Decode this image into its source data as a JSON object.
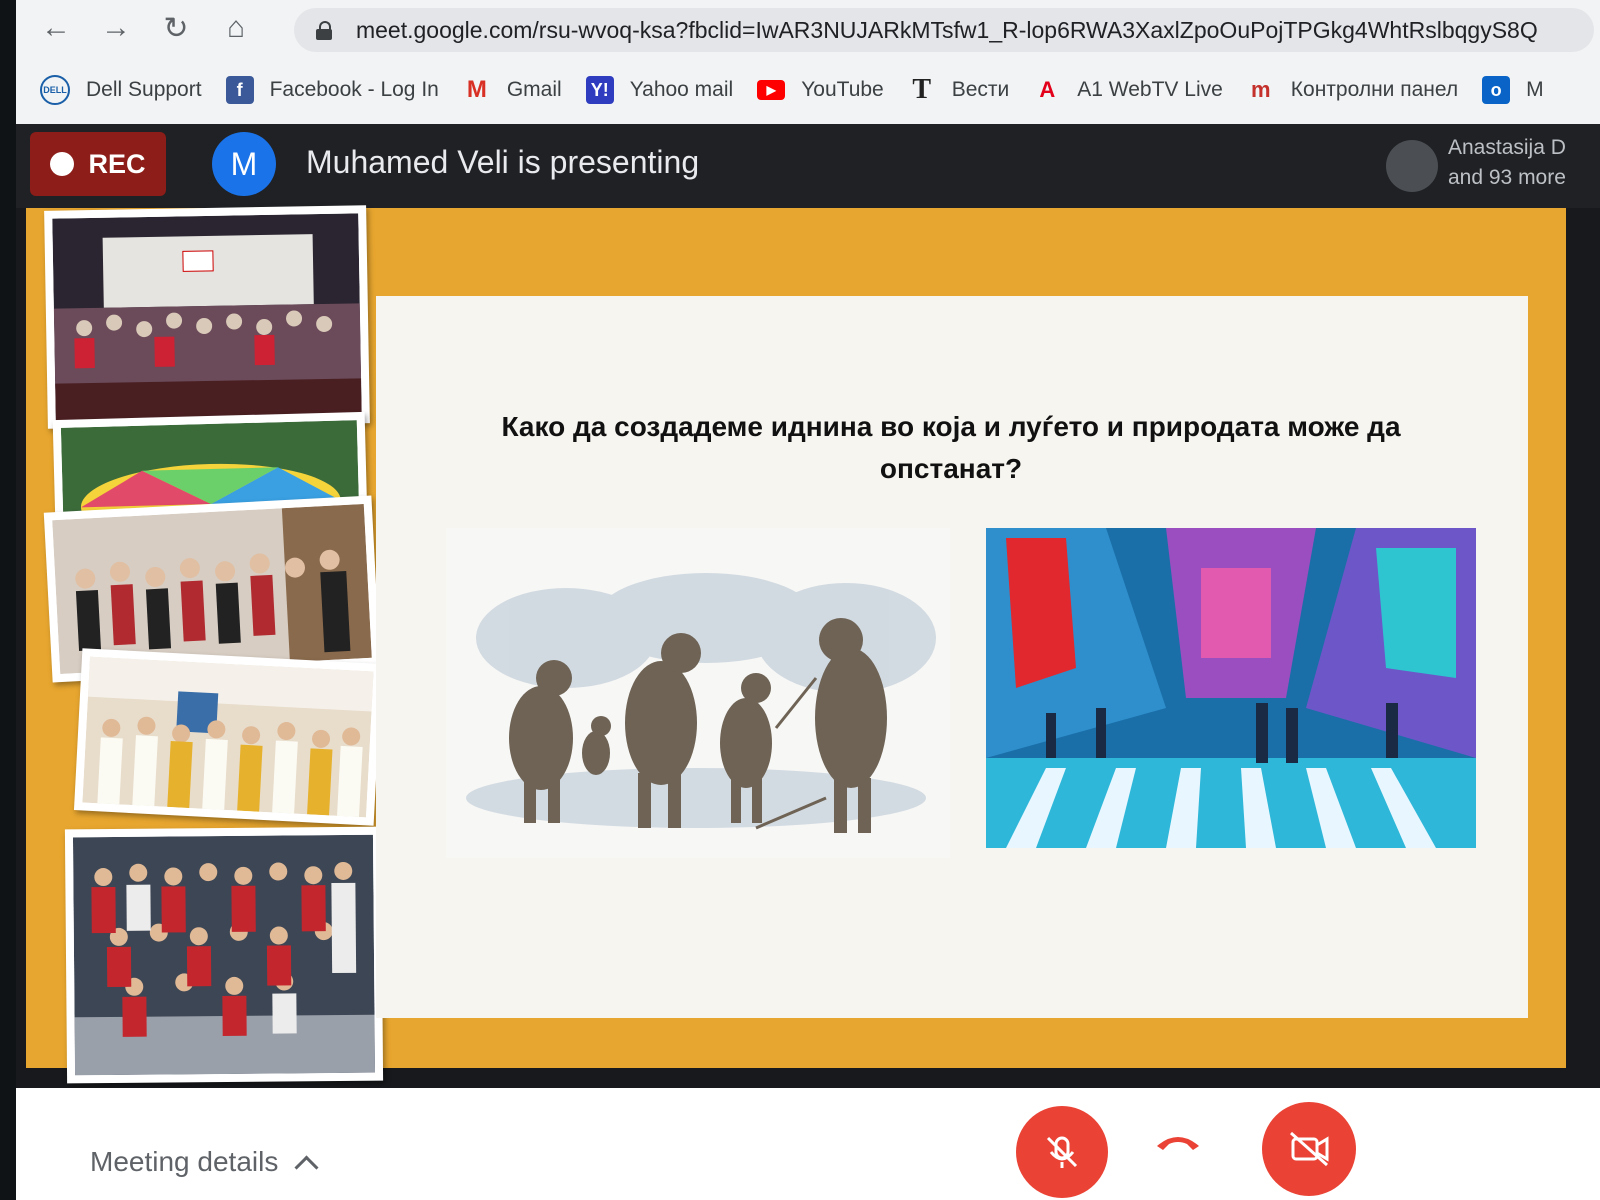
{
  "browser": {
    "url": "meet.google.com/rsu-wvoq-ksa?fbclid=IwAR3NUJARkMTsfw1_R-lop6RWA3XaxlZpoOuPojTPGkg4WhtRslbqgyS8Q",
    "bookmarks": [
      {
        "label": "Dell Support",
        "icon": "dell-icon",
        "color": "#1a5fa8"
      },
      {
        "label": "Facebook - Log In",
        "icon": "facebook-icon",
        "color": "#3b5998"
      },
      {
        "label": "Gmail",
        "icon": "gmail-icon",
        "color": "#d93025"
      },
      {
        "label": "Yahoo mail",
        "icon": "yahoo-icon",
        "color": "#2f3cc0"
      },
      {
        "label": "YouTube",
        "icon": "youtube-icon",
        "color": "#ff0000"
      },
      {
        "label": "Вести",
        "icon": "vesti-icon",
        "color": "#222222"
      },
      {
        "label": "A1 WebTV Live",
        "icon": "a1-icon",
        "color": "#e2001a"
      },
      {
        "label": "Контролни панел",
        "icon": "control-panel-icon",
        "color": "#c4302b"
      },
      {
        "label": "M",
        "icon": "outlook-icon",
        "color": "#0a64c8"
      }
    ]
  },
  "meet": {
    "rec_label": "REC",
    "presenter_initial": "M",
    "presenting_text": "Muhamed Veli is presenting",
    "participant_name": "Anastasija D",
    "participant_more": "and 93 more"
  },
  "slide": {
    "title": "Како да создадеме иднина во која и луѓето и природата може да опстанат?",
    "frame_color": "#e7a62f"
  },
  "toolbar": {
    "meeting_details": "Meeting details"
  },
  "colors": {
    "accent_red": "#ea4335",
    "rec_red": "#8c1d18",
    "meet_dark": "#1f2124"
  }
}
